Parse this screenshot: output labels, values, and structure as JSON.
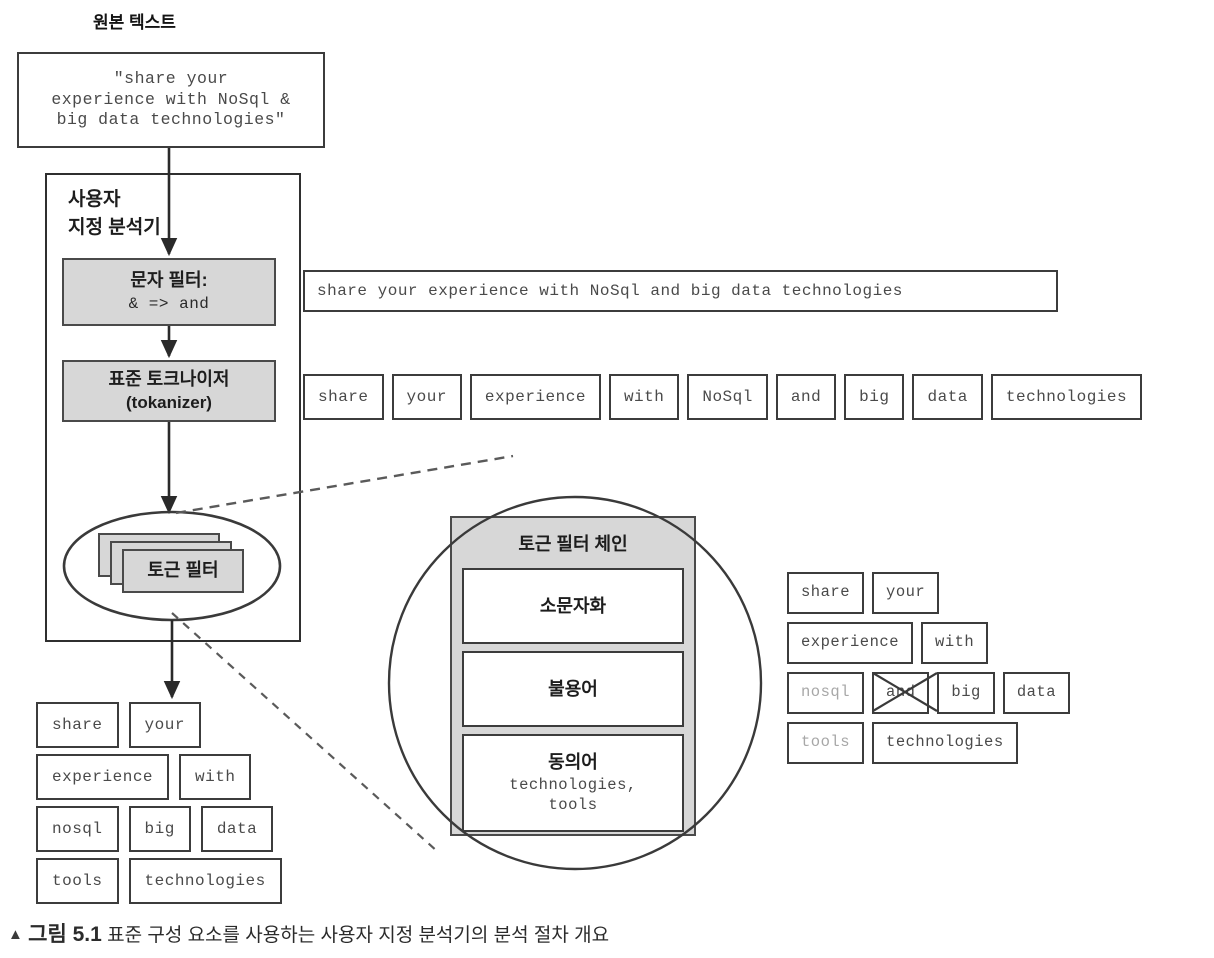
{
  "figure": {
    "source_label": "원본 텍스트",
    "caption_marker": "▲",
    "caption_number": "그림 5.1",
    "caption_text": "표준 구성 요소를 사용하는 사용자 지정 분석기의 분석 절차 개요"
  },
  "source_text": {
    "line1": "\"share your",
    "line2": "experience with NoSql &",
    "line3": "big data technologies\""
  },
  "analyzer": {
    "title_line1": "사용자",
    "title_line2": "지정 분석기",
    "char_filter": {
      "line1": "문자 필터:",
      "line2": "&  =>  and"
    },
    "tokenizer": {
      "line1": "표준 토크나이저",
      "line2": "(tokanizer)"
    },
    "token_filter": {
      "label": "토근 필터"
    }
  },
  "char_filter_output": {
    "sentence": "share your experience with NoSql and big data technologies"
  },
  "tokenizer_output": {
    "tokens": [
      "share",
      "your",
      "experience",
      "with",
      "NoSql",
      "and",
      "big",
      "data",
      "technologies"
    ]
  },
  "magnifier": {
    "chain_title": "토근 필터 체인",
    "filters": [
      {
        "name": "소문자화",
        "detail": ""
      },
      {
        "name": "불용어",
        "detail": ""
      },
      {
        "name": "동의어",
        "detail": "technologies,\ntools"
      }
    ]
  },
  "token_filter_output_right": {
    "rows": [
      [
        {
          "text": "share",
          "state": "normal"
        },
        {
          "text": "your",
          "state": "normal"
        }
      ],
      [
        {
          "text": "experience",
          "state": "normal"
        },
        {
          "text": "with",
          "state": "normal"
        }
      ],
      [
        {
          "text": "nosql",
          "state": "faded"
        },
        {
          "text": "and",
          "state": "removed"
        },
        {
          "text": "big",
          "state": "normal"
        },
        {
          "text": "data",
          "state": "normal"
        }
      ],
      [
        {
          "text": "tools",
          "state": "faded"
        },
        {
          "text": "technologies",
          "state": "normal"
        }
      ]
    ]
  },
  "final_output": {
    "rows": [
      [
        "share",
        "your"
      ],
      [
        "experience",
        "with"
      ],
      [
        "nosql",
        "big",
        "data"
      ],
      [
        "tools",
        "technologies"
      ]
    ]
  },
  "colors": {
    "stroke": "#3c3c3c",
    "gray_fill": "#d7d7d7",
    "faded_text": "#a7a7a7",
    "background": "#ffffff"
  }
}
